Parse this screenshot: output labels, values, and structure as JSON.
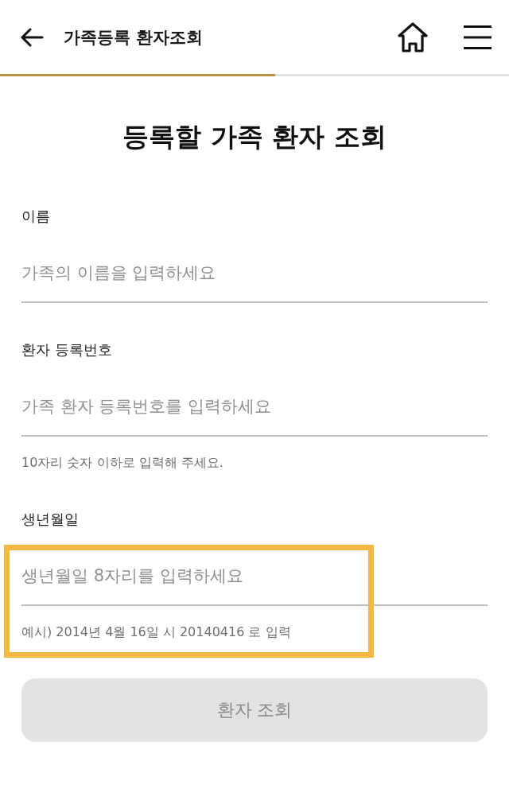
{
  "header": {
    "title": "가족등록 환자조회"
  },
  "progress": {
    "level": 0.54
  },
  "page_title": "등록할 가족 환자 조회",
  "fields": [
    {
      "label": "이름",
      "placeholder": "가족의 이름을 입력하세요",
      "highlighted": false
    },
    {
      "label": "환자 등록번호",
      "placeholder": "가족 환자 등록번호를 입력하세요",
      "helper": "10자리 숫자 이하로 입력해 주세요.",
      "highlighted": false
    },
    {
      "label": "생년월일",
      "placeholder": "생년월일 8자리를 입력하세요",
      "helper": "예시) 2014년 4월 16일 시 20140416 로 입력",
      "highlighted": true
    }
  ],
  "submit_button": {
    "label": "환자 조회",
    "disabled": true
  }
}
